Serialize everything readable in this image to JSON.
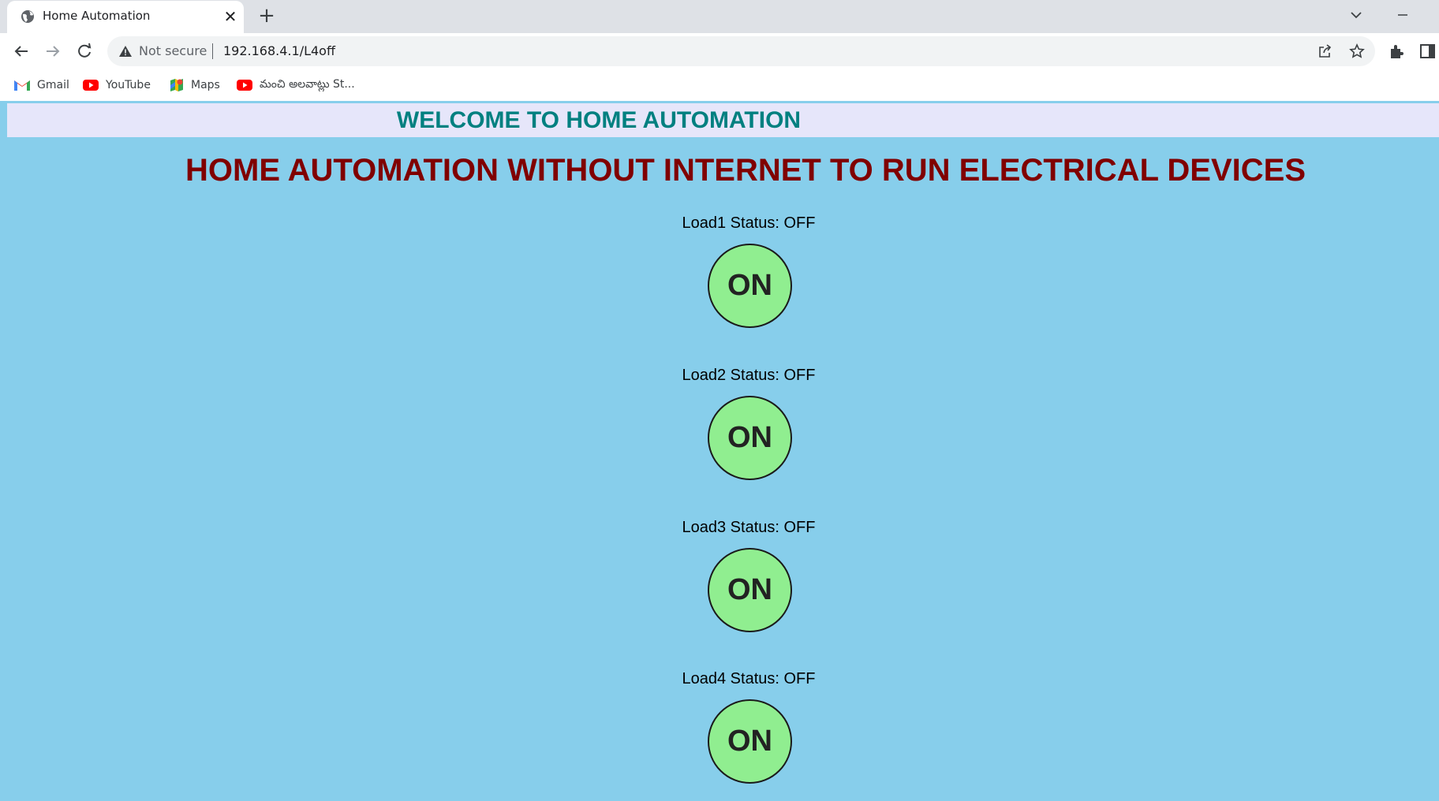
{
  "browser": {
    "tab_title": "Home Automation",
    "tab_close": "✕",
    "new_tab": "+",
    "security_label": "Not secure",
    "url": "192.168.4.1/L4off",
    "bookmarks": [
      {
        "label": "Gmail",
        "icon": "gmail-icon"
      },
      {
        "label": "YouTube",
        "icon": "youtube-icon"
      },
      {
        "label": "Maps",
        "icon": "maps-icon"
      },
      {
        "label": "మంచి అలవాట్లు St...",
        "icon": "youtube-icon"
      }
    ]
  },
  "page": {
    "welcome": "WELCOME TO HOME AUTOMATION",
    "heading": "HOME AUTOMATION WITHOUT INTERNET TO RUN ELECTRICAL DEVICES",
    "loads": [
      {
        "status": "Load1 Status: OFF",
        "button": "ON"
      },
      {
        "status": "Load2 Status: OFF",
        "button": "ON"
      },
      {
        "status": "Load3 Status: OFF",
        "button": "ON"
      },
      {
        "status": "Load4 Status: OFF",
        "button": "ON"
      }
    ]
  },
  "colors": {
    "page_bg": "#87CEEB",
    "welcome_bg": "#E6E6FA",
    "welcome_text": "#008080",
    "heading_text": "#800000",
    "button_bg": "#90EE90"
  }
}
